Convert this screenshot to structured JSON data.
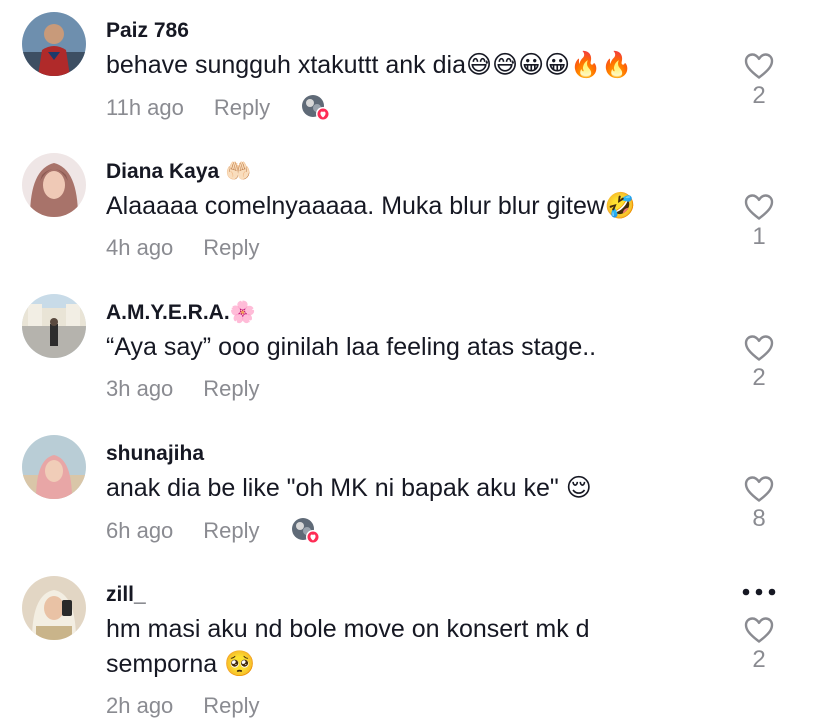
{
  "comments": [
    {
      "username": "Paiz 786",
      "text": "behave sungguh xtakuttt ank dia😅😅😀😀🔥🔥",
      "time": "11h ago",
      "reply": "Reply",
      "likes": "2",
      "creator_liked": true
    },
    {
      "username": "Diana Kaya 🤲🏻",
      "text": "Alaaaaa comelnyaaaaa. Muka blur blur gitew🤣",
      "time": "4h ago",
      "reply": "Reply",
      "likes": "1",
      "creator_liked": false
    },
    {
      "username": "A.M.Y.E.R.A.🌸",
      "text": "“Aya say” ooo ginilah laa feeling atas stage..",
      "time": "3h ago",
      "reply": "Reply",
      "likes": "2",
      "creator_liked": false
    },
    {
      "username": "shunajiha",
      "text": "anak dia be like \"oh MK ni bapak aku ke\" 😌",
      "time": "6h ago",
      "reply": "Reply",
      "likes": "8",
      "creator_liked": true
    },
    {
      "username": "zill_",
      "text": "hm masi aku nd bole move on konsert mk d semporna 🥺",
      "time": "2h ago",
      "reply": "Reply",
      "likes": "2",
      "creator_liked": false
    }
  ],
  "colors": {
    "text_primary": "#161823",
    "text_secondary": "#8a8b91",
    "heart_outline": "#8a8b91",
    "liked_badge": "#fe2c55"
  },
  "icons": {
    "like": "heart-outline-icon",
    "more": "more-horizontal-icon",
    "creator_liked": "creator-liked-badge-icon"
  }
}
